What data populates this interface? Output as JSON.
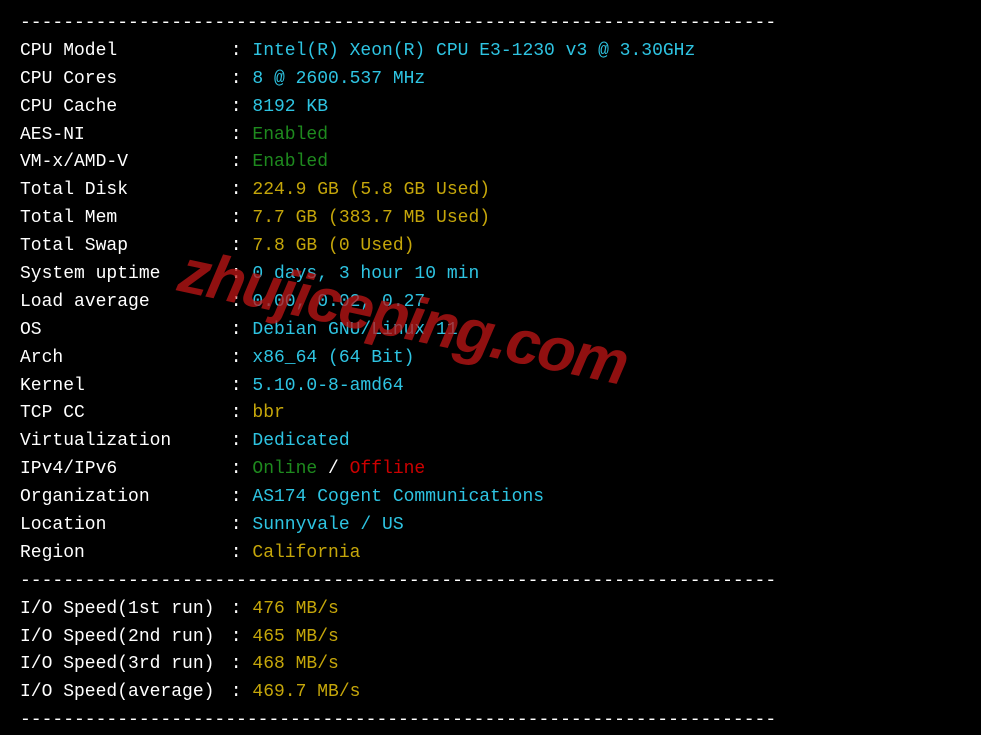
{
  "divider": "----------------------------------------------------------------------",
  "rows1": [
    {
      "label": "CPU Model",
      "value": "Intel(R) Xeon(R) CPU E3-1230 v3 @ 3.30GHz",
      "cls": "val-cyan"
    },
    {
      "label": "CPU Cores",
      "value": "8 @ 2600.537 MHz",
      "cls": "val-cyan"
    },
    {
      "label": "CPU Cache",
      "value": "8192 KB",
      "cls": "val-cyan"
    },
    {
      "label": "AES-NI",
      "value": "Enabled",
      "cls": "val-green"
    },
    {
      "label": "VM-x/AMD-V",
      "value": "Enabled",
      "cls": "val-green"
    },
    {
      "label": "Total Disk",
      "value": "224.9 GB (5.8 GB Used)",
      "cls": "val-yellow"
    },
    {
      "label": "Total Mem",
      "value": "7.7 GB (383.7 MB Used)",
      "cls": "val-yellow"
    },
    {
      "label": "Total Swap",
      "value": "7.8 GB (0 Used)",
      "cls": "val-yellow"
    },
    {
      "label": "System uptime",
      "value": "0 days, 3 hour 10 min",
      "cls": "val-cyan"
    },
    {
      "label": "Load average",
      "value": "0.00, 0.02, 0.27",
      "cls": "val-cyan"
    },
    {
      "label": "OS",
      "value": "Debian GNU/Linux 11",
      "cls": "val-cyan"
    },
    {
      "label": "Arch",
      "value": "x86_64 (64 Bit)",
      "cls": "val-cyan"
    },
    {
      "label": "Kernel",
      "value": "5.10.0-8-amd64",
      "cls": "val-cyan"
    },
    {
      "label": "TCP CC",
      "value": "bbr",
      "cls": "val-yellow"
    },
    {
      "label": "Virtualization",
      "value": "Dedicated",
      "cls": "val-cyan"
    }
  ],
  "ipv_row": {
    "label": "IPv4/IPv6",
    "online": "Online",
    "sep": " / ",
    "offline": "Offline"
  },
  "rows2": [
    {
      "label": "Organization",
      "value": "AS174 Cogent Communications",
      "cls": "val-cyan"
    },
    {
      "label": "Location",
      "value": "Sunnyvale / US",
      "cls": "val-cyan"
    },
    {
      "label": "Region",
      "value": "California",
      "cls": "val-yellow"
    }
  ],
  "io_rows": [
    {
      "label": "I/O Speed(1st run) ",
      "value": "476 MB/s",
      "cls": "val-yellow"
    },
    {
      "label": "I/O Speed(2nd run) ",
      "value": "465 MB/s",
      "cls": "val-yellow"
    },
    {
      "label": "I/O Speed(3rd run) ",
      "value": "468 MB/s",
      "cls": "val-yellow"
    },
    {
      "label": "I/O Speed(average) ",
      "value": "469.7 MB/s",
      "cls": "val-yellow"
    }
  ],
  "watermark": "zhujiceping.com"
}
